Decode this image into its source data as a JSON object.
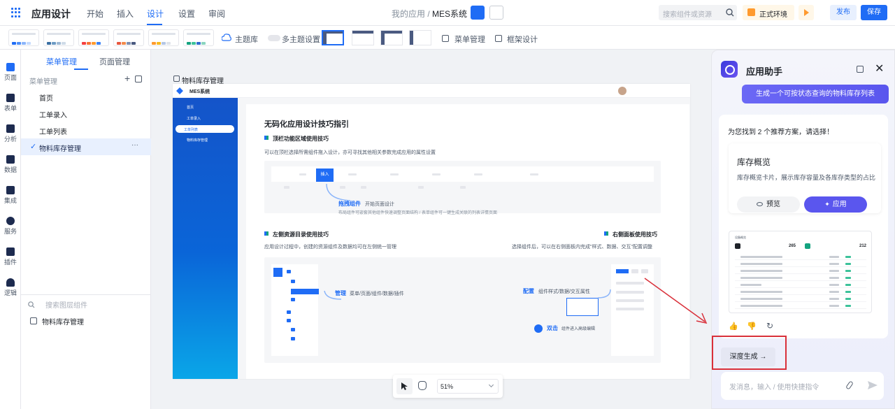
{
  "topbar": {
    "app_title": "应用设计",
    "nav": [
      "开始",
      "插入",
      "设计",
      "设置",
      "审阅"
    ],
    "active_nav": "设计",
    "breadcrumb_parent": "我的应用 /",
    "breadcrumb_current": "MES系统",
    "search_placeholder": "搜索组件或资源",
    "env_label": "正式环境",
    "publish_label": "发布",
    "save_label": "保存",
    "accent_color": "#1f6cf5"
  },
  "toolbar": {
    "theme_lib_label": "主题库",
    "multi_theme_label": "多主题设置",
    "menu_mgmt_label": "菜单管理",
    "frame_design_label": "框架设计"
  },
  "iconbar": {
    "items": [
      "页面",
      "表单",
      "分析",
      "数据",
      "集成",
      "服务",
      "插件",
      "逻辑"
    ]
  },
  "leftpanel": {
    "tabs": [
      "菜单管理",
      "页面管理"
    ],
    "header": "菜单管理",
    "menu_items": [
      "首页",
      "工单录入",
      "工单列表",
      "物料库存管理"
    ],
    "selected_check": "✓",
    "more": "···",
    "layer_search_placeholder": "搜索图层组件",
    "layer_item": "物料库存管理"
  },
  "canvas": {
    "page_title": "物料库存管理",
    "app_name": "MES系统",
    "sidebar_items": [
      "首页",
      "工单录入",
      "工单列表",
      "物料库存管理"
    ],
    "guide_title": "无码化应用设计技巧指引",
    "sec1_title": "顶栏功能区域使用技巧",
    "sec1_desc": "可以在顶栏选择所需组件拖入设计，亦可寻找其他相关参数完成应用的属性设置",
    "sec1_insert": "插入",
    "drag_title": "拖拽组件",
    "drag_sub": "开始页面设计",
    "drag_desc": "布局组件可嵌套其他组件快速调整页面结构 / 表单组件可一键生成关联的列表详情页面",
    "sec2_title": "左侧资源目录使用技巧",
    "sec2_desc": "应用设计过程中，创建的资源组件及数据均可在左侧统一管理",
    "manage_title": "管理",
    "manage_sub": "菜单/页面/组件/数据/插件",
    "sec3_title": "右侧面板使用技巧",
    "sec3_desc": "选择组件后，可以在右侧面板内完成\"样式、数据、交互\"配置调整",
    "config_title": "配置",
    "config_sub": "组件样式/数据/交互属性",
    "dbl_title": "双击",
    "dbl_sub": "组件进入高级编辑",
    "zoom": "51%"
  },
  "assistant": {
    "title": "应用助手",
    "user_message": "生成一个可按状态查询的物料库存列表",
    "recommend_text": "为您找到 2 个推荐方案，请选择！",
    "plan_title": "库存概览",
    "plan_desc": "库存概览卡片，展示库存容量及各库存类型的占比",
    "preview_label": "预览",
    "apply_label": "应用",
    "preview_header": "设备概览",
    "stat1_value": "265",
    "stat2_value": "212",
    "deep_label": "深度生成",
    "deep_arrow": "→",
    "input_placeholder": "发消息，输入 / 使用快捷指令",
    "brand_color": "#5a56ee"
  }
}
